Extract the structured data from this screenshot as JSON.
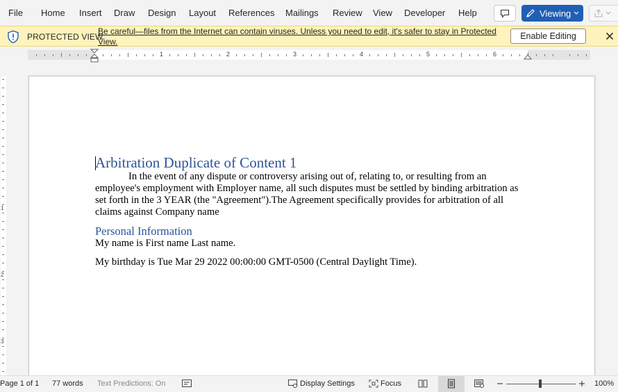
{
  "ribbon": {
    "tabs": [
      "File",
      "Home",
      "Insert",
      "Draw",
      "Design",
      "Layout",
      "References",
      "Mailings",
      "Review",
      "View",
      "Developer",
      "Help"
    ],
    "viewing_label": "Viewing"
  },
  "protected_view": {
    "label": "PROTECTED VIEW",
    "message": "Be careful—files from the Internet can contain viruses. Unless you need to edit, it's safer to stay in Protected View.",
    "enable_button": "Enable Editing"
  },
  "ruler": {
    "numbers": [
      "1",
      "2",
      "3",
      "4",
      "5",
      "6"
    ],
    "vnumbers": [
      "1",
      "2",
      "3"
    ]
  },
  "document": {
    "title": "Arbitration Duplicate of Content 1",
    "paragraph1": "In the event of any dispute or controversy arising out of, relating to, or resulting from an employee's employment with Employer name, all such disputes must be settled by binding arbitration as set forth in the 3 YEAR (the \"Agreement\").The Agreement specifically provides for arbitration of all claims against Company name",
    "heading2": "Personal Information",
    "line_name": "My name is First name Last name.",
    "line_birthday": "My birthday is Tue Mar 29 2022 00:00:00 GMT-0500 (Central Daylight Time)."
  },
  "status": {
    "page": "Page 1 of 1",
    "words": "77 words",
    "text_predictions": "Text Predictions: On",
    "display_settings": "Display Settings",
    "focus": "Focus",
    "zoom": "100%"
  },
  "colors": {
    "accent": "#1f5fb4",
    "heading": "#2f5496",
    "protected_bg": "#fdf3bb"
  }
}
